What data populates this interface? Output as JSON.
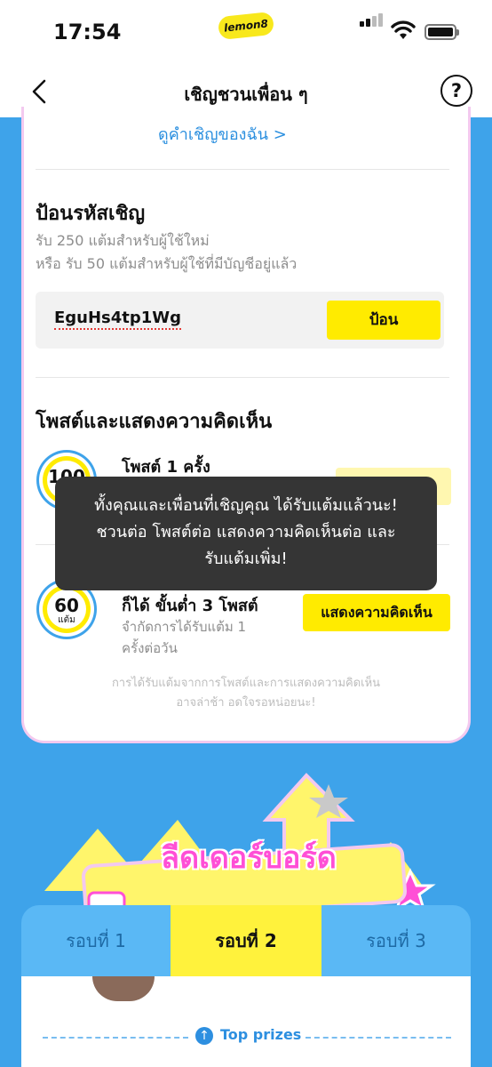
{
  "status_bar": {
    "time": "17:54",
    "app_badge": "lemon8"
  },
  "header": {
    "title": "เชิญชวนเพื่อน ๆ",
    "help": "?"
  },
  "card": {
    "my_invites_link": "ดูคำเชิญของฉัน",
    "invite_code_section": {
      "title": "ป้อนรหัสเชิญ",
      "subtitle_line1": "รับ 250 แต้มสำหรับผู้ใช้ใหม่",
      "subtitle_line2": "หรือ รับ 50 แต้มสำหรับผู้ใช้ที่มีบัญชีอยู่แล้ว",
      "code_value": "EguHs4tp1Wg",
      "enter_button": "ป้อน"
    },
    "tasks_section": {
      "title": "โพสต์และแสดงความคิดเห็น",
      "tasks": [
        {
          "points": "100",
          "unit": "แต้ม",
          "title": "โพสต์ 1 ครั้ง",
          "desc": "",
          "button": ""
        },
        {
          "points": "60",
          "unit": "แต้ม",
          "title": "ก็ได้ ขั้นต่ำ 3 โพสต์",
          "desc_line1": "จำกัดการได้รับแต้ม 1",
          "desc_line2": "ครั้งต่อวัน",
          "button": "แสดงความคิดเห็น"
        }
      ],
      "footnote_line1": "การได้รับแต้มจากการโพสต์และการแสดงความคิดเห็น",
      "footnote_line2": "อาจล่าช้า อดใจรอหน่อยนะ!"
    }
  },
  "toast": {
    "line1": "ทั้งคุณและเพื่อนที่เชิญคุณ ได้รับแต้มแล้วนะ!",
    "line2": "ชวนต่อ โพสต์ต่อ แสดงความคิดเห็นต่อ และ",
    "line3": "รับแต้มเพิ่ม!"
  },
  "leaderboard": {
    "banner_title": "ลีดเดอร์บอร์ด",
    "tabs": [
      {
        "label": "รอบที่ 1",
        "active": false
      },
      {
        "label": "รอบที่ 2",
        "active": true
      },
      {
        "label": "รอบที่ 3",
        "active": false
      }
    ],
    "top_prizes": "Top prizes"
  },
  "colors": {
    "accent_yellow": "#ffeb00",
    "background_blue": "#3ea3ea",
    "link_blue": "#2b8fdf",
    "pink": "#ff4fd6"
  }
}
